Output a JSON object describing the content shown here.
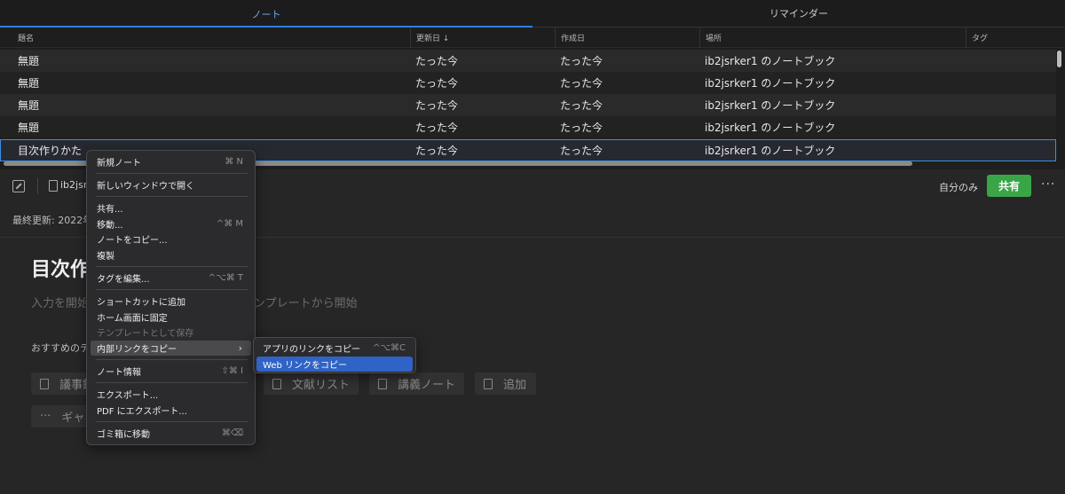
{
  "tabs": [
    {
      "label": "ノート"
    },
    {
      "label": "リマインダー"
    }
  ],
  "columns": [
    "題名",
    "更新日 ↓",
    "作成日",
    "場所",
    "タグ"
  ],
  "rows": [
    {
      "title": "無題",
      "updated": "たった今",
      "created": "たった今",
      "location": "ib2jsrker1 のノートブック"
    },
    {
      "title": "無題",
      "updated": "たった今",
      "created": "たった今",
      "location": "ib2jsrker1 のノートブック"
    },
    {
      "title": "無題",
      "updated": "たった今",
      "created": "たった今",
      "location": "ib2jsrker1 のノートブック"
    },
    {
      "title": "無題",
      "updated": "たった今",
      "created": "たった今",
      "location": "ib2jsrker1 のノートブック"
    },
    {
      "title": "目次作りかた",
      "updated": "たった今",
      "created": "たった今",
      "location": "ib2jsrker1 のノートブック"
    }
  ],
  "editor": {
    "notebook_label": "ib2jsr",
    "visibility": "自分のみ",
    "share_label": "共有",
    "more": "···",
    "last_updated": "最終更新: 2022年",
    "title": "目次作",
    "placeholder_start": "入力を開始",
    "placeholder_template": "ンプレートから開始",
    "recommend": "おすすめのテ",
    "chips": [
      "議事録",
      "文献リスト",
      "講義ノート",
      "追加"
    ],
    "more_chip": "ギャ"
  },
  "context_menu": {
    "items": [
      {
        "label": "新規ノート",
        "shortcut": "⌘ N"
      },
      {
        "label": "新しいウィンドウで開く",
        "shortcut": ""
      },
      {
        "label": "共有...",
        "shortcut": ""
      },
      {
        "label": "移動...",
        "shortcut": "^⌘ M"
      },
      {
        "label": "ノートをコピー...",
        "shortcut": ""
      },
      {
        "label": "複製",
        "shortcut": ""
      },
      {
        "label": "タグを編集...",
        "shortcut": "^⌥⌘ T"
      },
      {
        "label": "ショートカットに追加",
        "shortcut": ""
      },
      {
        "label": "ホーム画面に固定",
        "shortcut": ""
      },
      {
        "label": "テンプレートとして保存",
        "shortcut": ""
      },
      {
        "label": "内部リンクをコピー",
        "shortcut": ""
      },
      {
        "label": "ノート情報",
        "shortcut": "⇧⌘ I"
      },
      {
        "label": "エクスポート...",
        "shortcut": ""
      },
      {
        "label": "PDF にエクスポート...",
        "shortcut": ""
      },
      {
        "label": "ゴミ箱に移動",
        "shortcut": "⌘⌫"
      }
    ]
  },
  "submenu": {
    "items": [
      {
        "label": "アプリのリンクをコピー",
        "shortcut": "^⌥⌘C"
      },
      {
        "label": "Web リンクをコピー",
        "shortcut": ""
      }
    ]
  }
}
